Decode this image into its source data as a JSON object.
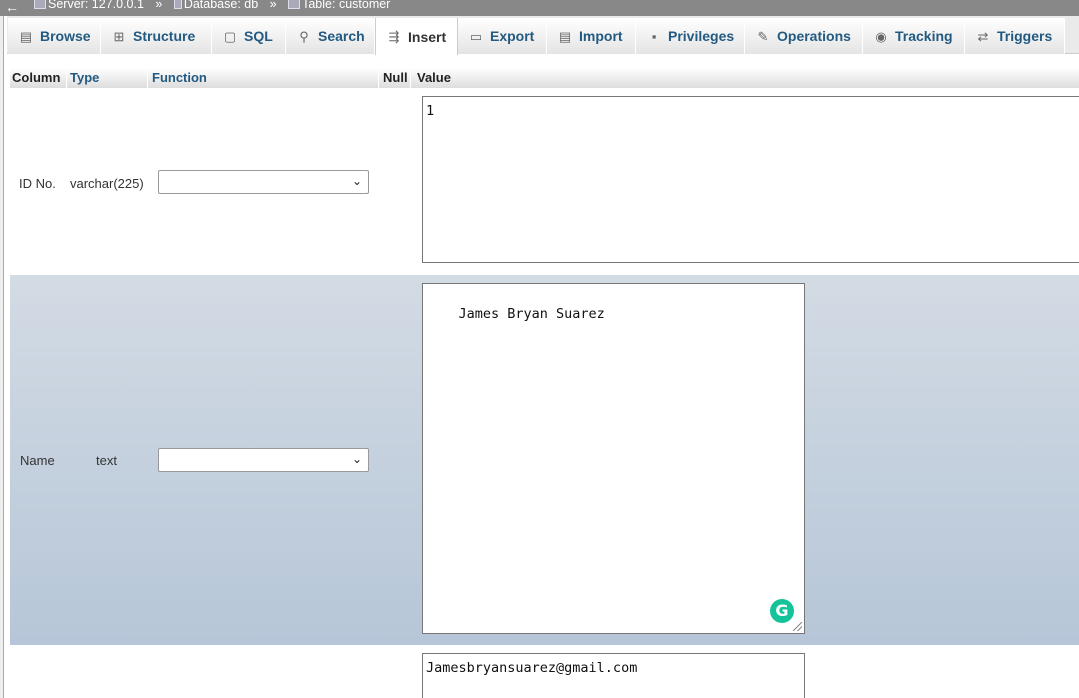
{
  "breadcrumb": {
    "back_icon": "←",
    "server": "Server: 127.0.0.1",
    "database": "Database: db",
    "table": "Table: customer",
    "separator": "»"
  },
  "tabs": [
    {
      "label": "Browse",
      "icon": "browse-icon",
      "glyph": "▤"
    },
    {
      "label": "Structure",
      "icon": "structure-icon",
      "glyph": "⊞"
    },
    {
      "label": "SQL",
      "icon": "sql-icon",
      "glyph": "▢"
    },
    {
      "label": "Search",
      "icon": "search-icon",
      "glyph": "⚲"
    },
    {
      "label": "Insert",
      "icon": "insert-icon",
      "glyph": "⇶"
    },
    {
      "label": "Export",
      "icon": "export-icon",
      "glyph": "▭"
    },
    {
      "label": "Import",
      "icon": "import-icon",
      "glyph": "▤"
    },
    {
      "label": "Privileges",
      "icon": "privileges-icon",
      "glyph": "▪"
    },
    {
      "label": "Operations",
      "icon": "wrench-icon",
      "glyph": "✎"
    },
    {
      "label": "Tracking",
      "icon": "eye-icon",
      "glyph": "◉"
    },
    {
      "label": "Triggers",
      "icon": "triggers-icon",
      "glyph": "⇄"
    }
  ],
  "active_tab": "Insert",
  "table_header": {
    "column": "Column",
    "type": "Type",
    "function": "Function",
    "null": "Null",
    "value": "Value"
  },
  "rows": [
    {
      "column": "ID No.",
      "type": "varchar(225)",
      "function": "",
      "value": "1"
    },
    {
      "column": "Name",
      "type": "text",
      "function": "",
      "value": "James Bryan Suarez"
    },
    {
      "column": "",
      "type": "",
      "function": "",
      "value": "Jamesbryansuarez@gmail.com"
    }
  ],
  "grammarly_glyph": "G"
}
